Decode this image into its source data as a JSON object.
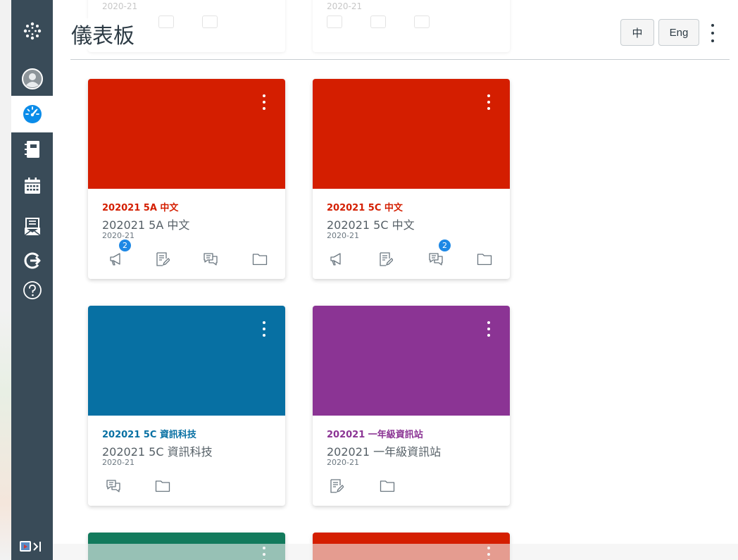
{
  "header": {
    "title": "儀表板",
    "lang_zh": "中",
    "lang_en": "Eng"
  },
  "nav": {
    "items": [
      {
        "icon": "canvas-logo-icon"
      },
      {
        "icon": "account-avatar-icon"
      },
      {
        "icon": "dashboard-icon",
        "active": true
      },
      {
        "icon": "courses-icon"
      },
      {
        "icon": "calendar-icon"
      },
      {
        "icon": "inbox-icon"
      },
      {
        "icon": "commons-icon"
      },
      {
        "icon": "help-icon"
      }
    ],
    "collapse_icon": "collapse-nav-icon"
  },
  "ghost_cards": [
    {
      "term": "2020-21"
    },
    {
      "term": "2020-21"
    }
  ],
  "cards": [
    {
      "short": "202021 5A 中文",
      "name": "202021 5A 中文",
      "term": "2020-21",
      "color": "#d41e00",
      "icons": [
        {
          "icon": "announcements-icon",
          "badge": "2"
        },
        {
          "icon": "assignments-icon"
        },
        {
          "icon": "discussions-icon"
        },
        {
          "icon": "files-icon"
        }
      ]
    },
    {
      "short": "202021 5C 中文",
      "name": "202021 5C 中文",
      "term": "2020-21",
      "color": "#d41e00",
      "icons": [
        {
          "icon": "announcements-icon"
        },
        {
          "icon": "assignments-icon"
        },
        {
          "icon": "discussions-icon",
          "badge": "2"
        },
        {
          "icon": "files-icon"
        }
      ]
    },
    {
      "short": "202021 5C 資訊科技",
      "name": "202021 5C 資訊科技",
      "term": "2020-21",
      "color": "#0770a3",
      "icons": [
        {
          "icon": "discussions-icon"
        },
        {
          "icon": "files-icon"
        }
      ]
    },
    {
      "short": "202021 一年級資訊站",
      "name": "202021 一年級資訊站",
      "term": "2020-21",
      "color": "#8b3494",
      "icons": [
        {
          "icon": "assignments-icon"
        },
        {
          "icon": "files-icon"
        }
      ]
    }
  ],
  "bottom_cards": [
    {
      "color": "#127a5c"
    },
    {
      "color": "#d41e00"
    }
  ]
}
